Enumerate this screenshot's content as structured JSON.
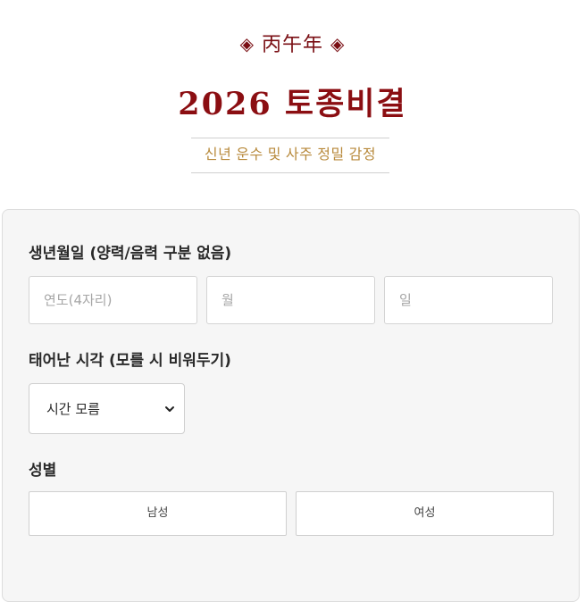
{
  "header": {
    "eyebrow_diamond": "◈",
    "eyebrow_text": "丙午年",
    "title": "2026 토종비결",
    "subtitle": "신년 운수 및 사주 정밀 감정"
  },
  "form": {
    "birth_label": "생년월일 (양력/음력 구분 없음)",
    "year_placeholder": "연도(4자리)",
    "month_placeholder": "월",
    "day_placeholder": "일",
    "time_label": "태어난 시각 (모를 시 비워두기)",
    "time_selected": "시간 모름",
    "gender_label": "성별",
    "gender_male": "남성",
    "gender_female": "여성"
  },
  "colors": {
    "accent": "#8b0e12",
    "gold": "#b88a3c",
    "card_bg": "#f6f6f6"
  },
  "icons": {
    "select_arrow": "chevron-down-icon",
    "ornament": "diamond-icon"
  }
}
